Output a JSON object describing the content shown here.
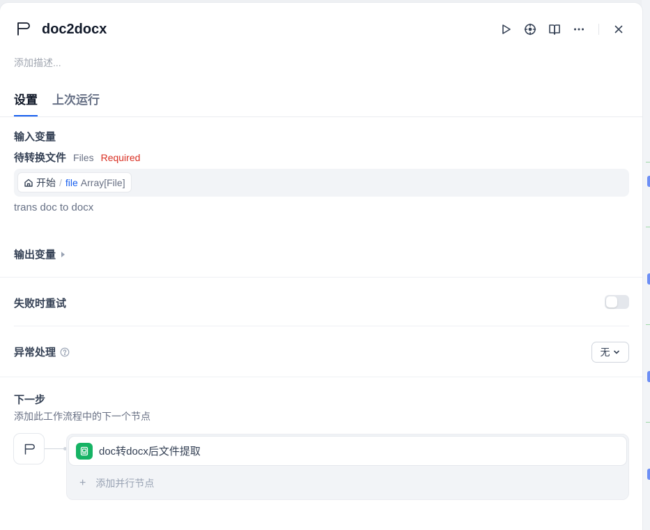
{
  "node": {
    "title": "doc2docx",
    "description_placeholder": "添加描述..."
  },
  "tabs": [
    {
      "label": "设置"
    },
    {
      "label": "上次运行"
    }
  ],
  "inputs": {
    "title": "输入变量",
    "field": {
      "name": "待转换文件",
      "type": "Files",
      "required": "Required"
    },
    "selector": {
      "node": "开始",
      "separator": "/",
      "var": "file",
      "type": "Array[File]"
    },
    "hint": "trans doc to docx"
  },
  "outputs": {
    "title": "输出变量"
  },
  "retry": {
    "label": "失败时重试",
    "enabled": false
  },
  "error_handling": {
    "label": "异常处理",
    "value": "无"
  },
  "next_step": {
    "title": "下一步",
    "subtitle": "添加此工作流程中的下一个节点",
    "node_label": "doc转docx后文件提取",
    "add_parallel": "添加并行节点"
  },
  "colors": {
    "accent": "#155eef",
    "required": "#d92d20",
    "node_badge": "#16b364"
  },
  "icons": [
    "flag-icon",
    "play-icon",
    "locate-icon",
    "book-icon",
    "more-icon",
    "close-icon",
    "home-icon",
    "help-icon",
    "chevron-down-icon",
    "document-extract-icon",
    "plus-icon"
  ]
}
